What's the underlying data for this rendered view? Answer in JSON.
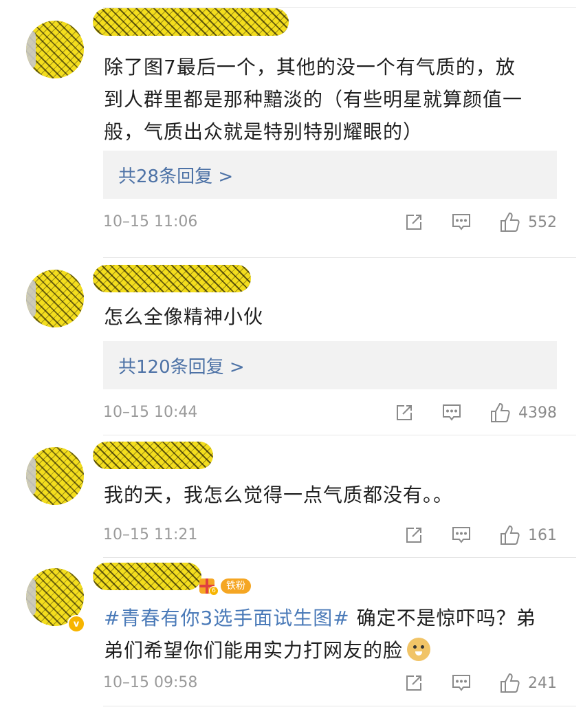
{
  "comments": [
    {
      "text": "除了图7最后一个，其他的没一个有气质的，放\n到人群里都是那种黯淡的（有些明星就算颜值一\n般，气质出众就是特别特别耀眼的）",
      "replies": "共28条回复 >",
      "time": "10–15 11:06",
      "likes": "552"
    },
    {
      "text": "怎么全像精神小伙",
      "replies": "共120条回复 >",
      "time": "10–15 10:44",
      "likes": "4398"
    },
    {
      "text": "我的天，我怎么觉得一点气质都没有。。",
      "time": "10–15 11:21",
      "likes": "161"
    },
    {
      "badge": "铁粉",
      "badge_tier": "6",
      "hashtag": "#青春有你3选手面试生图#",
      "text_line1": " 确定不是惊吓吗？弟",
      "text_line2": "弟们希望你们能用实力打网友的脸",
      "emoji": "doge-emoji",
      "time": "10–15 09:58",
      "likes": "241"
    }
  ],
  "icons": {
    "share": "share-icon",
    "comment": "comment-icon",
    "like": "thumbs-up-icon",
    "verified": "verified-v-icon"
  },
  "colors": {
    "link": "#4d72a6",
    "hashtag": "#4a7ab8",
    "meta": "#9a9a9a",
    "reply_bg": "#f2f2f2",
    "badge": "#f5a623"
  }
}
